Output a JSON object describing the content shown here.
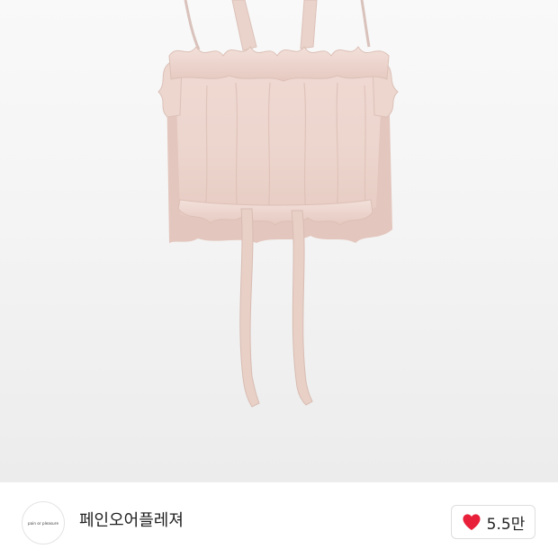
{
  "product": {
    "image_subject": "pink-ruffle-camisole-top"
  },
  "shop": {
    "avatar_text": "pain or pleasure",
    "name": "페인오어플레져"
  },
  "likes": {
    "count_label": "5.5만",
    "icon": "heart-icon",
    "heart_color": "#e8203a"
  },
  "colors": {
    "garment": "#ead2ca",
    "background": "#f4f4f4"
  }
}
